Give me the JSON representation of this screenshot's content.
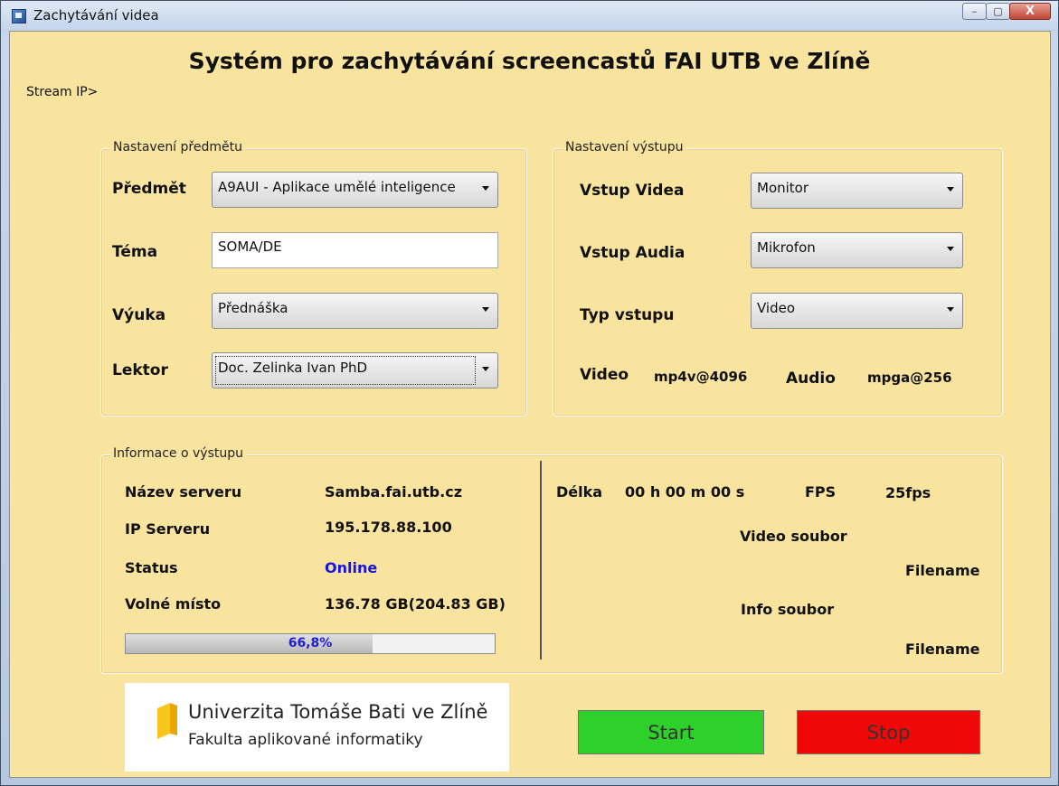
{
  "window": {
    "title": "Zachytávání videa",
    "minimize": "–",
    "maximize": "▢",
    "close": "X"
  },
  "heading": "Systém pro zachytávání screencastů FAI UTB ve Zlíně",
  "stream_ip_label": "Stream IP>",
  "subject_settings": {
    "legend": "Nastavení předmětu",
    "subject_label": "Předmět",
    "subject_value": "A9AUI - Aplikace umělé inteligence",
    "topic_label": "Téma",
    "topic_value": "SOMA/DE",
    "teaching_label": "Výuka",
    "teaching_value": "Přednáška",
    "lecturer_label": "Lektor",
    "lecturer_value": "Doc. Zelinka Ivan PhD"
  },
  "output_settings": {
    "legend": "Nastavení výstupu",
    "video_input_label": "Vstup Videa",
    "video_input_value": "Monitor",
    "audio_input_label": "Vstup Audia",
    "audio_input_value": "Mikrofon",
    "input_type_label": "Typ vstupu",
    "input_type_value": "Video",
    "video_label": "Video",
    "video_codec": "mp4v@4096",
    "audio_label": "Audio",
    "audio_codec": "mpga@256"
  },
  "output_info": {
    "legend": "Informace o výstupu",
    "server_name_label": "Název serveru",
    "server_name_value": "Samba.fai.utb.cz",
    "server_ip_label": "IP Serveru",
    "server_ip_value": "195.178.88.100",
    "status_label": "Status",
    "status_value": "Online",
    "status_color": "#1414e6",
    "free_space_label": "Volné místo",
    "free_space_value": "136.78 GB(204.83 GB)",
    "usage_fraction": 0.668,
    "usage_text": "66,8%",
    "length_label": "Délka",
    "length_value": "00 h 00 m 00 s",
    "fps_label": "FPS",
    "fps_value": "25fps",
    "video_file_label": "Video soubor",
    "video_file_value": "Filename",
    "info_file_label": "Info soubor",
    "info_file_value": "Filename"
  },
  "logo": {
    "line1": "Univerzita Tomáše Bati ve Zlíně",
    "line2": "Fakulta aplikované informatiky"
  },
  "buttons": {
    "start": "Start",
    "stop": "Stop",
    "start_color": "#2ed12a",
    "stop_color": "#f00707"
  }
}
